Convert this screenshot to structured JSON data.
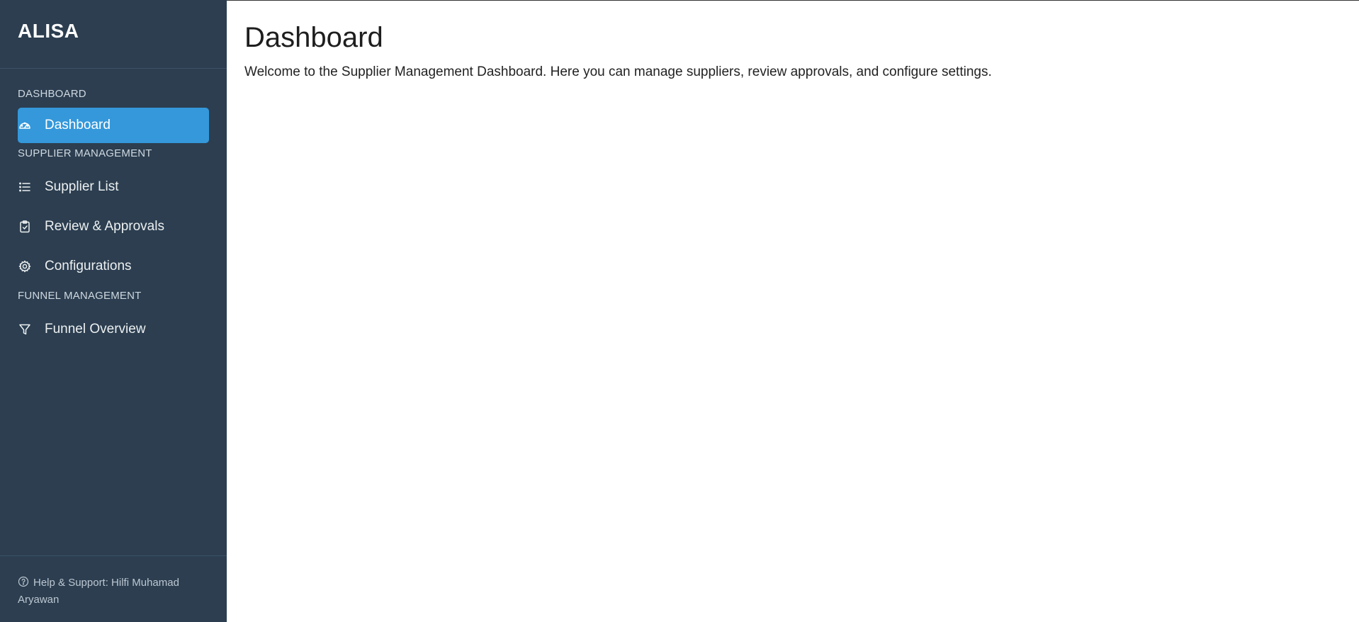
{
  "app": {
    "brand": "ALISA"
  },
  "sidebar": {
    "sections": [
      {
        "label": "DASHBOARD",
        "items": [
          {
            "label": "Dashboard",
            "icon": "gauge-icon",
            "active": true
          }
        ]
      },
      {
        "label": "SUPPLIER MANAGEMENT",
        "items": [
          {
            "label": "Supplier List",
            "icon": "list-icon",
            "active": false
          },
          {
            "label": "Review & Approvals",
            "icon": "clipboard-check-icon",
            "active": false
          },
          {
            "label": "Configurations",
            "icon": "gear-icon",
            "active": false
          }
        ]
      },
      {
        "label": "FUNNEL MANAGEMENT",
        "items": [
          {
            "label": "Funnel Overview",
            "icon": "funnel-icon",
            "active": false
          }
        ]
      }
    ],
    "footer": {
      "text": "Help & Support: Hilfi Muhamad Aryawan",
      "icon": "question-circle-icon"
    }
  },
  "main": {
    "title": "Dashboard",
    "description": "Welcome to the Supplier Management Dashboard. Here you can manage suppliers, review approvals, and configure settings."
  },
  "colors": {
    "sidebar_bg": "#2c3e50",
    "active_item_bg": "#3498db",
    "main_bg": "#ffffff"
  }
}
